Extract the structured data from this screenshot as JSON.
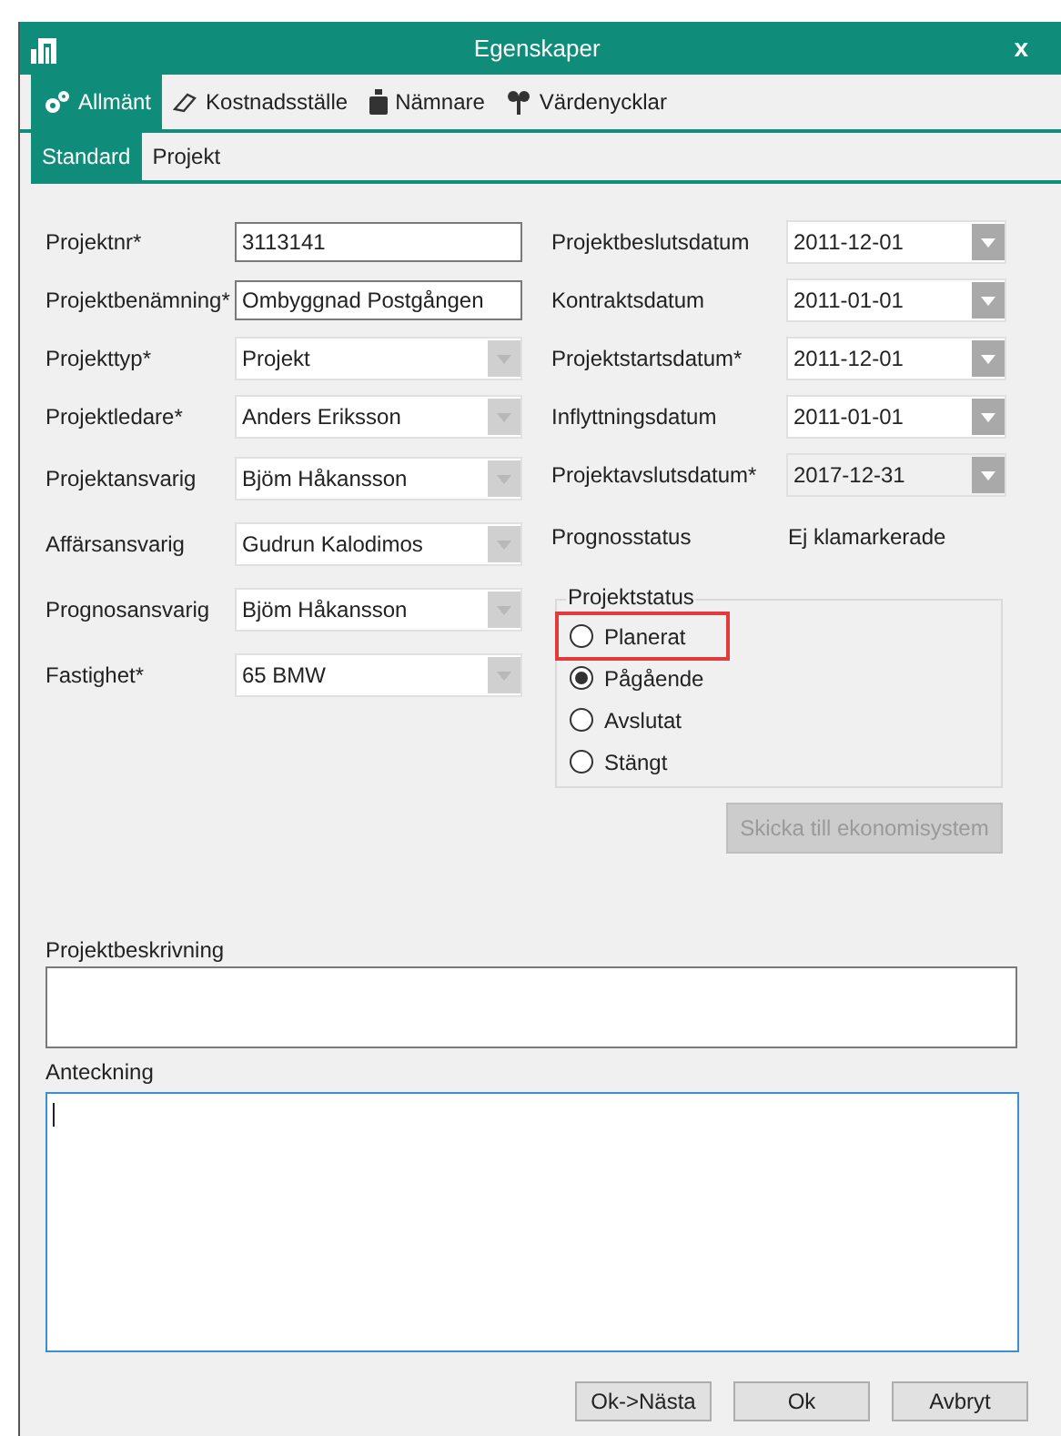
{
  "window": {
    "title": "Egenskaper",
    "close": "x"
  },
  "tabs": [
    {
      "label": "Allmänt",
      "kind": "gears",
      "selected": true
    },
    {
      "label": "Kostnadsställe",
      "kind": "eraser",
      "selected": false
    },
    {
      "label": "Nämnare",
      "kind": "weight",
      "selected": false
    },
    {
      "label": "Värdenycklar",
      "kind": "keys",
      "selected": false
    }
  ],
  "subtabs": [
    {
      "label": "Standard",
      "selected": true
    },
    {
      "label": "Projekt",
      "selected": false
    }
  ],
  "left_fields": [
    {
      "label": "Projektnr*",
      "kind": "text",
      "value": "3113141"
    },
    {
      "label": "Projektbenämning*",
      "kind": "text",
      "value": "Ombyggnad Postgången"
    },
    {
      "label": "Projekttyp*",
      "kind": "combo",
      "value": "Projekt"
    },
    {
      "label": "Projektledare*",
      "kind": "combo",
      "value": "Anders Eriksson"
    },
    {
      "label": "Projektansvarig",
      "kind": "combo",
      "value": "Bjöm Håkansson"
    },
    {
      "label": "Affärsansvarig",
      "kind": "combo",
      "value": "Gudrun Kalodimos"
    },
    {
      "label": "Prognosansvarig",
      "kind": "combo",
      "value": "Bjöm Håkansson"
    },
    {
      "label": "Fastighet*",
      "kind": "combo",
      "value": "65 BMW"
    }
  ],
  "right_fields": [
    {
      "label": "Projektbeslutsdatum",
      "value": "2011-12-01",
      "disabled": false
    },
    {
      "label": "Kontraktsdatum",
      "value": "2011-01-01",
      "disabled": false
    },
    {
      "label": "Projektstartsdatum*",
      "value": "2011-12-01",
      "disabled": false
    },
    {
      "label": "Inflyttningsdatum",
      "value": "2011-01-01",
      "disabled": false
    },
    {
      "label": "Projektavslutsdatum*",
      "value": "2017-12-31",
      "disabled": true
    }
  ],
  "prognosis": {
    "label": "Prognosstatus",
    "value": "Ej klamarkerade"
  },
  "project_status": {
    "title": "Projektstatus",
    "options": [
      {
        "label": "Planerat",
        "selected": false,
        "highlighted": true
      },
      {
        "label": "Pågående",
        "selected": true,
        "highlighted": false
      },
      {
        "label": "Avslutat",
        "selected": false,
        "highlighted": false
      },
      {
        "label": "Stängt",
        "selected": false,
        "highlighted": false
      }
    ]
  },
  "send_button": {
    "label": "Skicka till ekonomisystem",
    "disabled": true
  },
  "description": {
    "label": "Projektbeskrivning"
  },
  "note": {
    "label": "Anteckning",
    "focused": true
  },
  "buttons": [
    "Ok->Nästa",
    "Ok",
    "Avbryt"
  ]
}
